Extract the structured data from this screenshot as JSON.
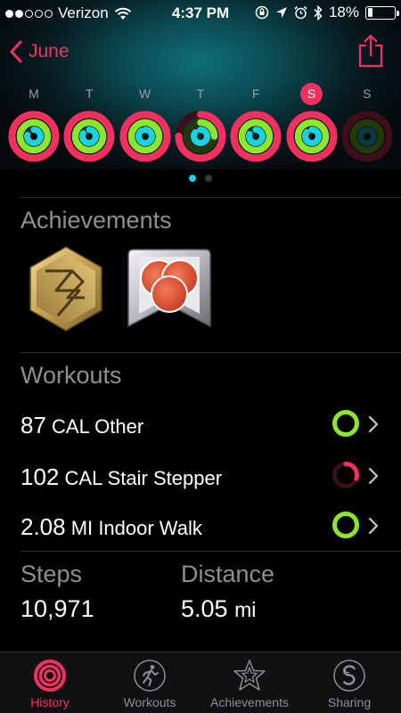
{
  "status_bar": {
    "carrier": "Verizon",
    "time": "4:37 PM",
    "battery": "18%",
    "battery_level": 0.18,
    "signal_bars": 2,
    "icons": [
      "wifi-icon",
      "rotation-lock-icon",
      "location-icon",
      "alarm-icon",
      "bluetooth-icon",
      "battery-icon"
    ]
  },
  "nav": {
    "back_label": "June",
    "back_icon": "chevron-left-icon",
    "share_icon": "share-icon"
  },
  "week": {
    "selected_index": 5,
    "days": [
      {
        "letter": "M",
        "move": 1.0,
        "exercise": 1.0,
        "stand": 0.78
      },
      {
        "letter": "T",
        "move": 1.0,
        "exercise": 1.0,
        "stand": 0.82
      },
      {
        "letter": "W",
        "move": 1.0,
        "exercise": 1.0,
        "stand": 0.9
      },
      {
        "letter": "T",
        "move": 0.75,
        "exercise": 0.25,
        "stand": 0.85
      },
      {
        "letter": "F",
        "move": 1.0,
        "exercise": 1.0,
        "stand": 0.8
      },
      {
        "letter": "S",
        "move": 1.0,
        "exercise": 1.0,
        "stand": 0.85
      },
      {
        "letter": "S",
        "move": 0.0,
        "exercise": 0.0,
        "stand": 0.0
      }
    ]
  },
  "pager": {
    "count": 2,
    "active": 0
  },
  "achievements": {
    "title": "Achievements",
    "badges": [
      "perfect-week-badge",
      "workout-record-badge"
    ]
  },
  "workouts": {
    "title": "Workouts",
    "items": [
      {
        "value": "87",
        "unit": "CAL",
        "name": "Other",
        "ring_color": "#8ce62b",
        "ring_progress": 1.0
      },
      {
        "value": "102",
        "unit": "CAL",
        "name": "Stair Stepper",
        "ring_color": "#f2305f",
        "ring_progress": 0.3
      },
      {
        "value": "2.08",
        "unit": "MI",
        "name": "Indoor Walk",
        "ring_color": "#8ce62b",
        "ring_progress": 1.0
      }
    ]
  },
  "stats": {
    "steps_label": "Steps",
    "steps_value": "10,971",
    "distance_label": "Distance",
    "distance_value": "5.05",
    "distance_unit": "mi"
  },
  "tabs": [
    {
      "label": "History",
      "icon": "history-rings-icon",
      "active": true
    },
    {
      "label": "Workouts",
      "icon": "running-figure-icon",
      "active": false
    },
    {
      "label": "Achievements",
      "icon": "star-badge-icon",
      "active": false
    },
    {
      "label": "Sharing",
      "icon": "sharing-icon",
      "active": false
    }
  ],
  "colors": {
    "accent": "#f2305f",
    "move": "#f2305f",
    "exercise": "#8ce62b",
    "stand": "#19d3e0",
    "secondary_text": "#8e8e93"
  }
}
